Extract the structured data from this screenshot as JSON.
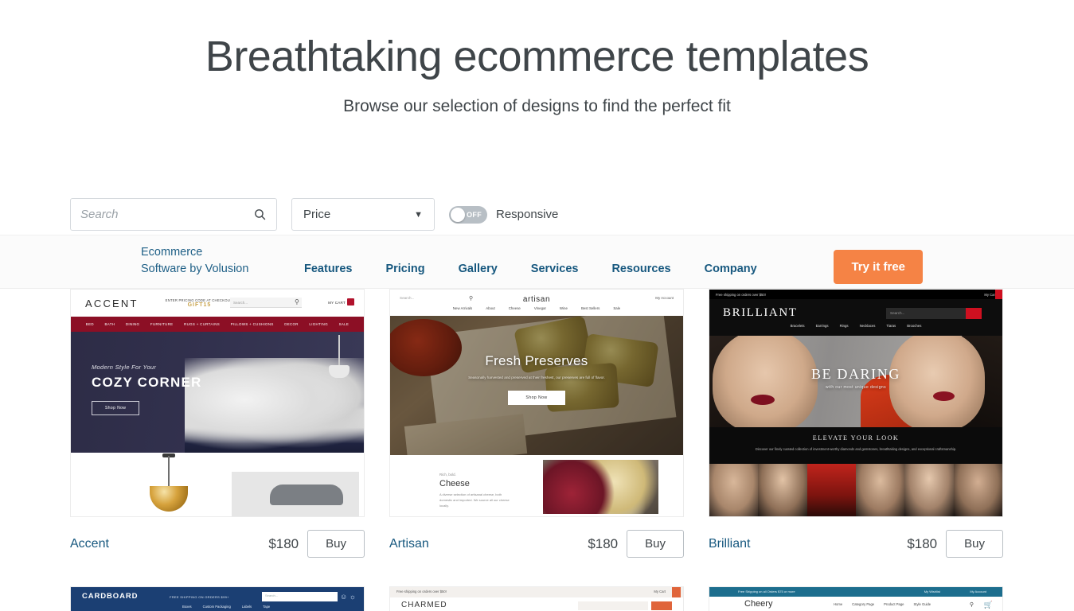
{
  "hero": {
    "title": "Breathtaking ecommerce templates",
    "subtitle": "Browse our selection of designs to find the perfect fit"
  },
  "filters": {
    "search_placeholder": "Search",
    "search_value": "",
    "price_label": "Price",
    "toggle_state": "OFF",
    "toggle_label": "Responsive"
  },
  "nav": {
    "logo_line1": "Ecommerce",
    "logo_line2": "Software by Volusion",
    "links": [
      "Features",
      "Pricing",
      "Gallery",
      "Services",
      "Resources",
      "Company"
    ],
    "cta": "Try it free",
    "cta_color": "#f58345"
  },
  "templates": [
    {
      "name": "Accent",
      "price": "$180",
      "buy": "Buy",
      "preview": {
        "logo": "ACCENT",
        "promo_line1": "ENTER PRICING CODE AT CHECKOUT!",
        "promo_line2": "GIFT15",
        "search_placeholder": "Search...",
        "cart": "MY CART",
        "nav": [
          "BED",
          "BATH",
          "DINING",
          "FURNITURE",
          "RUGS + CURTAINS",
          "PILLOWS + CUSHIONS",
          "DECOR",
          "LIGHTING",
          "SALE"
        ],
        "hero_eyebrow": "Modern Style For Your",
        "hero_title": "COZY CORNER",
        "hero_cta": "Shop Now"
      }
    },
    {
      "name": "Artisan",
      "price": "$180",
      "buy": "Buy",
      "preview": {
        "logo": "artisan",
        "search_placeholder": "Search...",
        "account": "My Account",
        "nav": [
          "New Arrivals",
          "About",
          "Cheese",
          "Vinegar",
          "Wine",
          "Best Sellers",
          "Sale"
        ],
        "hero_title": "Fresh Preserves",
        "hero_sub": "Seasonally harvested and preserved at their freshest, our preserves are full of flavor.",
        "hero_cta": "Shop Now",
        "section_eyebrow": "Rich, bold.",
        "section_title": "Cheese",
        "section_text": "A diverse selection of artisanal cheese, both domestic and imported. We source all our cheese locally."
      }
    },
    {
      "name": "Brilliant",
      "price": "$180",
      "buy": "Buy",
      "preview": {
        "logo": "BRILLIANT",
        "ship_bar": "Free shipping on orders over $50!",
        "cart": "My Cart",
        "search_placeholder": "Search...",
        "nav": [
          "Bracelets",
          "Earrings",
          "Rings",
          "Necklaces",
          "Tiaras",
          "Brooches"
        ],
        "hero_title": "BE DARING",
        "hero_sub": "with our most unique designs",
        "section_title": "ELEVATE YOUR LOOK",
        "section_text": "Discover our finely curated collection of investment-worthy diamonds and gemstones, breathtaking designs, and exceptional craftsmanship."
      }
    }
  ],
  "templates_row2": [
    {
      "name": "Cardboard",
      "preview": {
        "logo": "CARDBOARD",
        "ship_bar": "FREE SHIPPING ON ORDERS $99+",
        "search_placeholder": "Search...",
        "nav": [
          "Boxes",
          "Custom Packaging",
          "Labels",
          "Tape"
        ]
      }
    },
    {
      "name": "Charmed",
      "preview": {
        "logo": "CHARMED",
        "ship_bar": "Free shipping on orders over $50!",
        "cart": "My Cart"
      }
    },
    {
      "name": "Cheery",
      "preview": {
        "logo": "Cheery",
        "ship_bar": "Free Shipping on all Orders $75 or more",
        "wishlist": "My Wishlist",
        "account": "My Account",
        "nav": [
          "Home",
          "Category Page",
          "Product Page",
          "Style Guide"
        ]
      }
    }
  ]
}
